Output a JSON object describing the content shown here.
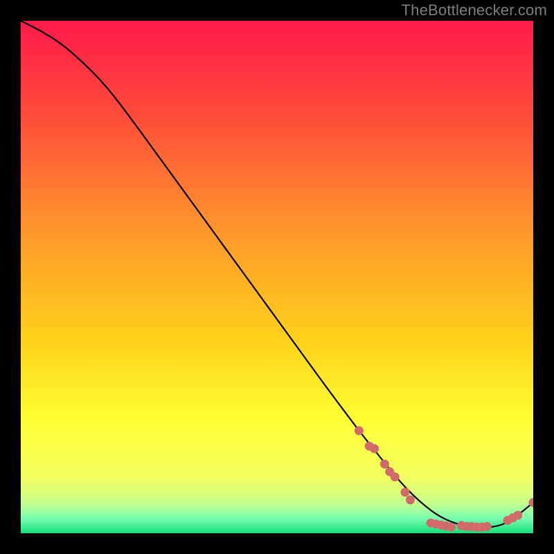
{
  "attribution": "TheBottlenecker.com",
  "colors": {
    "bg": "#000000",
    "gradient_top": "#ff1a4a",
    "gradient_mid_top": "#ff7a2a",
    "gradient_mid": "#ffd11a",
    "gradient_mid_bottom": "#ffff33",
    "gradient_bottom1": "#e8ff66",
    "gradient_bottom2": "#7cffb0",
    "gradient_bottom3": "#14e07b",
    "curve": "#000000",
    "marker": "#d36a6a"
  },
  "chart_data": {
    "type": "line",
    "title": "",
    "xlabel": "",
    "ylabel": "",
    "xlim": [
      0,
      100
    ],
    "ylim": [
      0,
      100
    ],
    "series": [
      {
        "name": "curve",
        "x": [
          0,
          4,
          8,
          12,
          16,
          20,
          28,
          36,
          44,
          52,
          60,
          66,
          70,
          74,
          78,
          82,
          86,
          90,
          94,
          97,
          100
        ],
        "y": [
          100,
          98,
          95.5,
          92,
          88,
          83,
          72,
          61,
          50,
          39,
          28,
          20,
          15,
          10,
          6,
          3,
          1.5,
          1,
          1.5,
          3.5,
          6
        ]
      }
    ],
    "markers": [
      {
        "x": 66,
        "y": 20
      },
      {
        "x": 68,
        "y": 17
      },
      {
        "x": 69,
        "y": 16.5
      },
      {
        "x": 71,
        "y": 13.5
      },
      {
        "x": 72,
        "y": 12
      },
      {
        "x": 73,
        "y": 11
      },
      {
        "x": 75,
        "y": 8
      },
      {
        "x": 76,
        "y": 6.5
      },
      {
        "x": 80,
        "y": 2.0
      },
      {
        "x": 81,
        "y": 1.8
      },
      {
        "x": 82,
        "y": 1.6
      },
      {
        "x": 83,
        "y": 1.4
      },
      {
        "x": 84,
        "y": 1.2
      },
      {
        "x": 86,
        "y": 1.5
      },
      {
        "x": 87,
        "y": 1.3
      },
      {
        "x": 88,
        "y": 1.3
      },
      {
        "x": 89,
        "y": 1.2
      },
      {
        "x": 90,
        "y": 1.2
      },
      {
        "x": 91,
        "y": 1.3
      },
      {
        "x": 95,
        "y": 2.5
      },
      {
        "x": 96,
        "y": 3.0
      },
      {
        "x": 97,
        "y": 3.5
      },
      {
        "x": 100,
        "y": 6
      }
    ]
  }
}
